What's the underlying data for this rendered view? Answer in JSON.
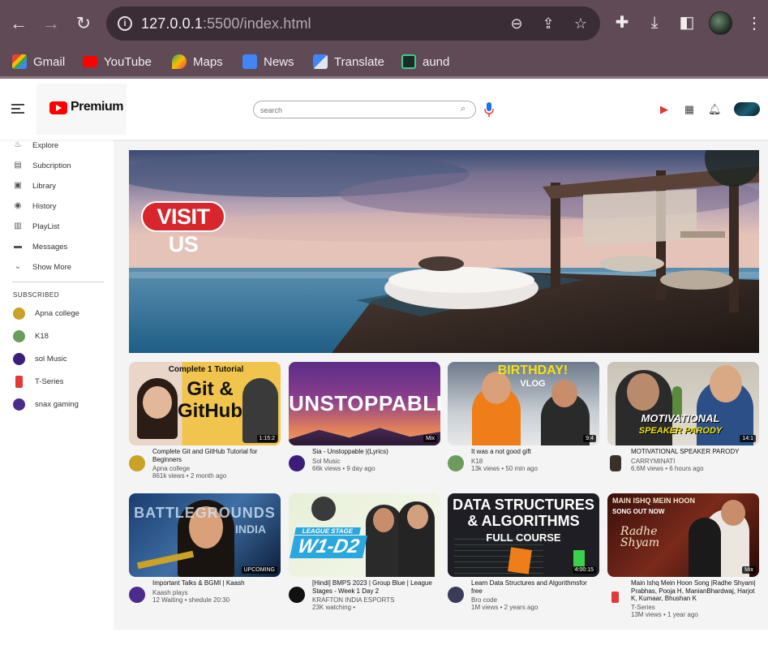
{
  "browser": {
    "url_host": "127.0.0.1",
    "url_rest": ":5500/index.html",
    "bookmarks": [
      {
        "label": "Gmail",
        "icon": "gmail-icon",
        "color": "#ea4335"
      },
      {
        "label": "YouTube",
        "icon": "youtube-icon",
        "color": "#ff0000"
      },
      {
        "label": "Maps",
        "icon": "maps-icon",
        "color": "#34a853"
      },
      {
        "label": "News",
        "icon": "news-icon",
        "color": "#4285f4"
      },
      {
        "label": "Translate",
        "icon": "translate-icon",
        "color": "#4285f4"
      },
      {
        "label": "aund",
        "icon": "aund-icon",
        "color": "#1c2a2a"
      }
    ]
  },
  "header": {
    "logo": "Premium",
    "search_placeholder": "search"
  },
  "sidebar": {
    "items": [
      {
        "label": "Explore",
        "icon": "explore-icon"
      },
      {
        "label": "Subcription",
        "icon": "subscription-icon"
      },
      {
        "label": "Library",
        "icon": "library-icon"
      },
      {
        "label": "History",
        "icon": "history-icon"
      },
      {
        "label": "PlayList",
        "icon": "playlist-icon"
      },
      {
        "label": "Messages",
        "icon": "messages-icon"
      },
      {
        "label": "Show More",
        "icon": "chevron-down-icon"
      }
    ],
    "subscribed_heading": "SUBSCRIBED",
    "subscriptions": [
      {
        "label": "Apna college"
      },
      {
        "label": "K18"
      },
      {
        "label": "sol Music"
      },
      {
        "label": "T-Series"
      },
      {
        "label": "snax gaming"
      }
    ]
  },
  "hero": {
    "badge": "VISIT US"
  },
  "videos": [
    {
      "title": "Complete Git and GitHub Tutorial for Beginners",
      "channel": "Apna college",
      "stats": "861k views • 2 month ago",
      "thumb_text": "Git & GitHub",
      "thumb_sub": "Complete 1 Tutorial",
      "duration": "1:15:2"
    },
    {
      "title": "Sia - Unstoppable |(Lyrics)",
      "channel": "Sol Music",
      "stats": "66k views • 9 day ago",
      "thumb_text": "UNSTOPPABLE",
      "duration": "Mix"
    },
    {
      "title": "It was a not good gift",
      "channel": "K18",
      "stats": "13k views • 50 min ago",
      "thumb_text": "BIRTHDAY!",
      "thumb_sub": "VLOG",
      "duration": "9:4"
    },
    {
      "title": "MOTIVATIONAL SPEAKER PARODY",
      "channel": "CARRYMINATI",
      "stats": "6.6M views • 6 hours ago",
      "thumb_text": "MOTIVATIONAL",
      "thumb_sub": "SPEAKER PARODY",
      "duration": "14:1"
    },
    {
      "title": "Important Talks & BGMI | Kaash",
      "channel": "Kaash plays",
      "stats": "12 Waiting • shedule 20:30",
      "thumb_text": "BATTLEGROUNDS",
      "thumb_sub": "INDIA",
      "duration": "UPCOMING"
    },
    {
      "title": "[Hindi] BMPS 2023 | Group Blue | League Stages - Week 1 Day 2",
      "channel": "KRAFTON INDIA ESPORTS",
      "stats": "23K watching •",
      "thumb_text": "W1-D2",
      "thumb_sub": "LEAGUE STAGE"
    },
    {
      "title": "Learn Data Structures and Algorithmsfor free",
      "channel": "Bro code",
      "stats": "1M views • 2 years ago",
      "thumb_text": "DATA STRUCTURES",
      "thumb_sub": "& ALGORITHMS",
      "thumb_sub2": "FULL COURSE",
      "duration": "4:00:15"
    },
    {
      "title": "Main Ishq Mein Hoon Song |Radhe Shyam| Prabhas, Pooja H, ManianBhardwaj, Harjot K, Kumaar, Bhushan K",
      "channel": "T-Series",
      "stats": "13M views • 1 year ago",
      "thumb_text": "MAIN ISHQ MEIN HOON",
      "thumb_sub": "SONG OUT NOW",
      "duration": "Mix"
    }
  ]
}
